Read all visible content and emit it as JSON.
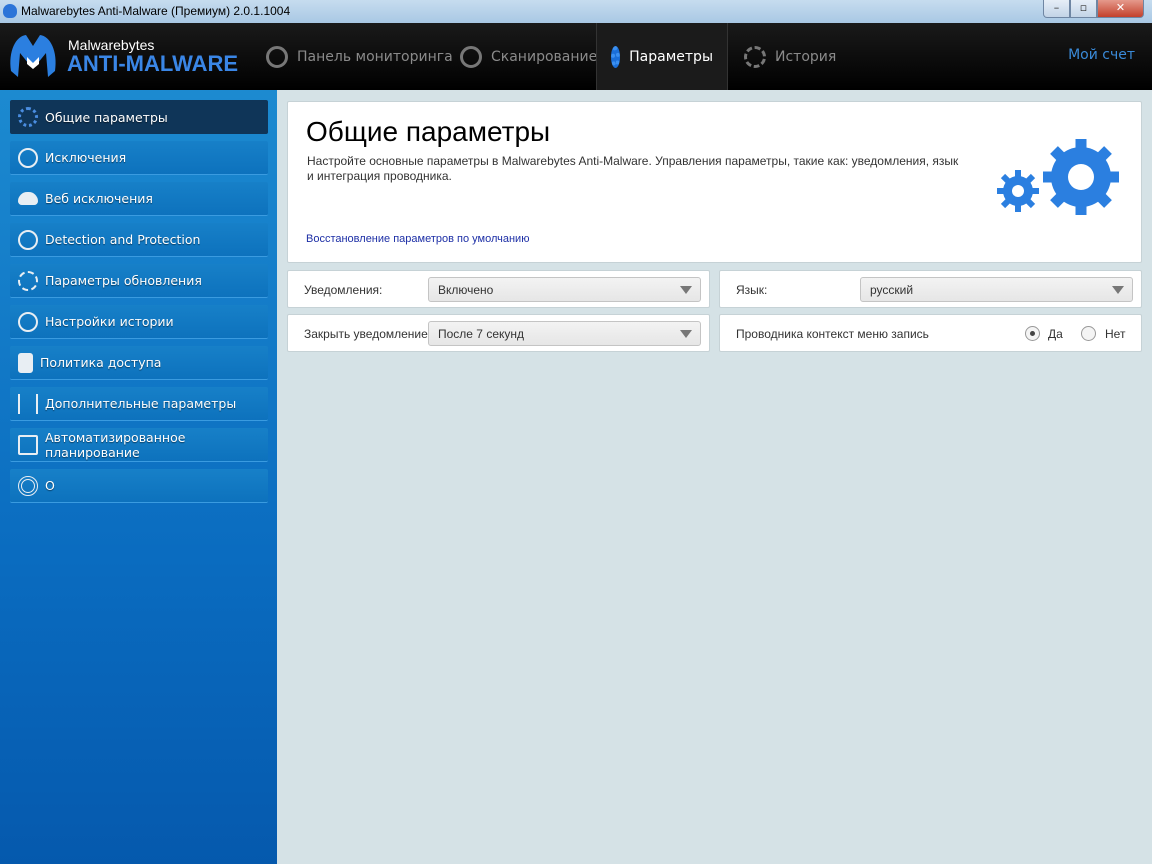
{
  "window": {
    "title": "Malwarebytes Anti-Malware (Премиум)  2.0.1.1004"
  },
  "header": {
    "logo_small": "Malwarebytes",
    "logo_large": "ANTI-MALWARE",
    "tabs": [
      {
        "label": "Панель мониторинга",
        "icon": "dashboard-icon"
      },
      {
        "label": "Сканирование",
        "icon": "scan-icon"
      },
      {
        "label": "Параметры",
        "icon": "gear-icon",
        "active": true
      },
      {
        "label": "История",
        "icon": "history-icon"
      }
    ],
    "account": "Мой счет"
  },
  "sidebar": {
    "items": [
      {
        "label": "Общие параметры",
        "icon": "gears-icon",
        "active": true
      },
      {
        "label": "Исключения",
        "icon": "block-icon"
      },
      {
        "label": "Веб исключения",
        "icon": "cloud-icon"
      },
      {
        "label": "Detection and Protection",
        "icon": "radar-icon"
      },
      {
        "label": "Параметры обновления",
        "icon": "refresh-icon"
      },
      {
        "label": "Настройки истории",
        "icon": "clock-icon"
      },
      {
        "label": "Политика доступа",
        "icon": "lock-icon"
      },
      {
        "label": "Дополнительные параметры",
        "icon": "sliders-icon"
      },
      {
        "label": "Автоматизированное планирование",
        "icon": "calendar-icon"
      },
      {
        "label": "О",
        "icon": "lifebuoy-icon"
      }
    ]
  },
  "main": {
    "title": "Общие параметры",
    "description": "Настройте основные параметры в Malwarebytes Anti-Malware. Управления параметры, такие как: уведомления, язык и интеграция проводника.",
    "restore_link": "Восстановление параметров по умолчанию",
    "notifications": {
      "label": "Уведомления:",
      "value": "Включено"
    },
    "language": {
      "label": "Язык:",
      "value": "русский"
    },
    "close_notification": {
      "label": "Закрыть уведомление",
      "value": "После 7 секунд"
    },
    "context_menu": {
      "label": "Проводника контекст меню запись",
      "yes": "Да",
      "no": "Нет",
      "selected": "yes"
    },
    "accent": "#2b7fe0"
  }
}
